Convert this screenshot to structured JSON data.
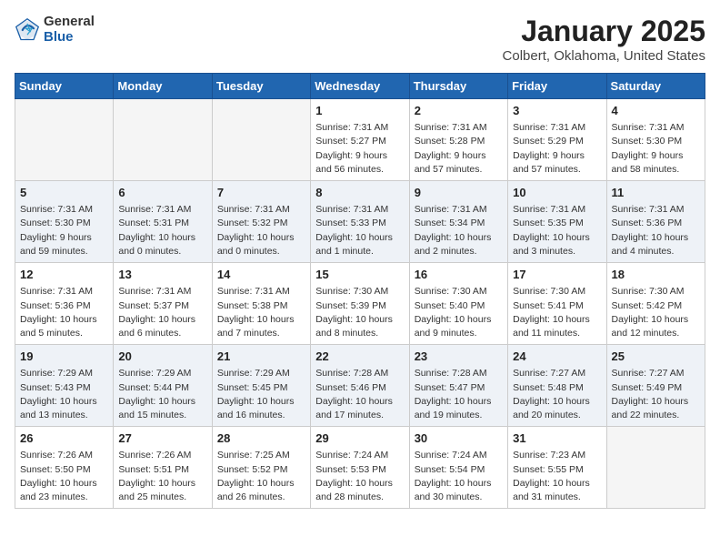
{
  "logo": {
    "general": "General",
    "blue": "Blue"
  },
  "title": "January 2025",
  "subtitle": "Colbert, Oklahoma, United States",
  "days_of_week": [
    "Sunday",
    "Monday",
    "Tuesday",
    "Wednesday",
    "Thursday",
    "Friday",
    "Saturday"
  ],
  "weeks": [
    [
      {
        "day": "",
        "info": ""
      },
      {
        "day": "",
        "info": ""
      },
      {
        "day": "",
        "info": ""
      },
      {
        "day": "1",
        "info": "Sunrise: 7:31 AM\nSunset: 5:27 PM\nDaylight: 9 hours and 56 minutes."
      },
      {
        "day": "2",
        "info": "Sunrise: 7:31 AM\nSunset: 5:28 PM\nDaylight: 9 hours and 57 minutes."
      },
      {
        "day": "3",
        "info": "Sunrise: 7:31 AM\nSunset: 5:29 PM\nDaylight: 9 hours and 57 minutes."
      },
      {
        "day": "4",
        "info": "Sunrise: 7:31 AM\nSunset: 5:30 PM\nDaylight: 9 hours and 58 minutes."
      }
    ],
    [
      {
        "day": "5",
        "info": "Sunrise: 7:31 AM\nSunset: 5:30 PM\nDaylight: 9 hours and 59 minutes."
      },
      {
        "day": "6",
        "info": "Sunrise: 7:31 AM\nSunset: 5:31 PM\nDaylight: 10 hours and 0 minutes."
      },
      {
        "day": "7",
        "info": "Sunrise: 7:31 AM\nSunset: 5:32 PM\nDaylight: 10 hours and 0 minutes."
      },
      {
        "day": "8",
        "info": "Sunrise: 7:31 AM\nSunset: 5:33 PM\nDaylight: 10 hours and 1 minute."
      },
      {
        "day": "9",
        "info": "Sunrise: 7:31 AM\nSunset: 5:34 PM\nDaylight: 10 hours and 2 minutes."
      },
      {
        "day": "10",
        "info": "Sunrise: 7:31 AM\nSunset: 5:35 PM\nDaylight: 10 hours and 3 minutes."
      },
      {
        "day": "11",
        "info": "Sunrise: 7:31 AM\nSunset: 5:36 PM\nDaylight: 10 hours and 4 minutes."
      }
    ],
    [
      {
        "day": "12",
        "info": "Sunrise: 7:31 AM\nSunset: 5:36 PM\nDaylight: 10 hours and 5 minutes."
      },
      {
        "day": "13",
        "info": "Sunrise: 7:31 AM\nSunset: 5:37 PM\nDaylight: 10 hours and 6 minutes."
      },
      {
        "day": "14",
        "info": "Sunrise: 7:31 AM\nSunset: 5:38 PM\nDaylight: 10 hours and 7 minutes."
      },
      {
        "day": "15",
        "info": "Sunrise: 7:30 AM\nSunset: 5:39 PM\nDaylight: 10 hours and 8 minutes."
      },
      {
        "day": "16",
        "info": "Sunrise: 7:30 AM\nSunset: 5:40 PM\nDaylight: 10 hours and 9 minutes."
      },
      {
        "day": "17",
        "info": "Sunrise: 7:30 AM\nSunset: 5:41 PM\nDaylight: 10 hours and 11 minutes."
      },
      {
        "day": "18",
        "info": "Sunrise: 7:30 AM\nSunset: 5:42 PM\nDaylight: 10 hours and 12 minutes."
      }
    ],
    [
      {
        "day": "19",
        "info": "Sunrise: 7:29 AM\nSunset: 5:43 PM\nDaylight: 10 hours and 13 minutes."
      },
      {
        "day": "20",
        "info": "Sunrise: 7:29 AM\nSunset: 5:44 PM\nDaylight: 10 hours and 15 minutes."
      },
      {
        "day": "21",
        "info": "Sunrise: 7:29 AM\nSunset: 5:45 PM\nDaylight: 10 hours and 16 minutes."
      },
      {
        "day": "22",
        "info": "Sunrise: 7:28 AM\nSunset: 5:46 PM\nDaylight: 10 hours and 17 minutes."
      },
      {
        "day": "23",
        "info": "Sunrise: 7:28 AM\nSunset: 5:47 PM\nDaylight: 10 hours and 19 minutes."
      },
      {
        "day": "24",
        "info": "Sunrise: 7:27 AM\nSunset: 5:48 PM\nDaylight: 10 hours and 20 minutes."
      },
      {
        "day": "25",
        "info": "Sunrise: 7:27 AM\nSunset: 5:49 PM\nDaylight: 10 hours and 22 minutes."
      }
    ],
    [
      {
        "day": "26",
        "info": "Sunrise: 7:26 AM\nSunset: 5:50 PM\nDaylight: 10 hours and 23 minutes."
      },
      {
        "day": "27",
        "info": "Sunrise: 7:26 AM\nSunset: 5:51 PM\nDaylight: 10 hours and 25 minutes."
      },
      {
        "day": "28",
        "info": "Sunrise: 7:25 AM\nSunset: 5:52 PM\nDaylight: 10 hours and 26 minutes."
      },
      {
        "day": "29",
        "info": "Sunrise: 7:24 AM\nSunset: 5:53 PM\nDaylight: 10 hours and 28 minutes."
      },
      {
        "day": "30",
        "info": "Sunrise: 7:24 AM\nSunset: 5:54 PM\nDaylight: 10 hours and 30 minutes."
      },
      {
        "day": "31",
        "info": "Sunrise: 7:23 AM\nSunset: 5:55 PM\nDaylight: 10 hours and 31 minutes."
      },
      {
        "day": "",
        "info": ""
      }
    ]
  ]
}
